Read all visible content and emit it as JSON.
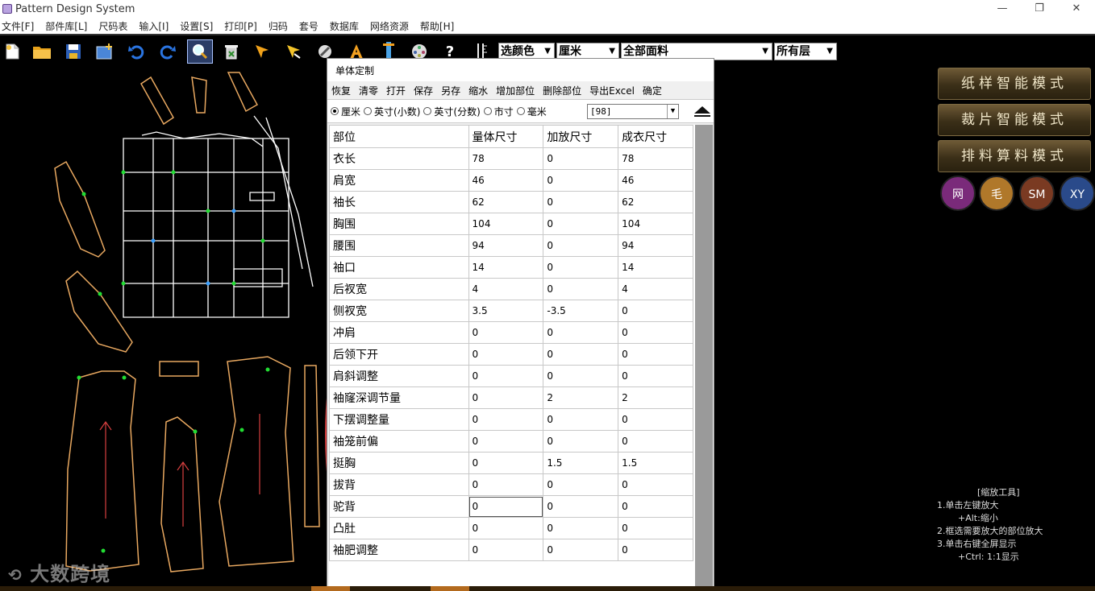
{
  "window": {
    "title": "Pattern Design System",
    "controls": [
      "—",
      "❐",
      "✕"
    ]
  },
  "menu": [
    "文件[F]",
    "部件库[L]",
    "尺码表",
    "输入[I]",
    "设置[S]",
    "打印[P]",
    "归码",
    "套号",
    "数据库",
    "网络资源",
    "帮助[H]"
  ],
  "toolbar": {
    "color_select": "选颜色",
    "unit_select": "厘米",
    "fabric_select": "全部面料",
    "layer_select": "所有层",
    "help_glyph": "?"
  },
  "dialog": {
    "title": "单体定制",
    "menu": [
      "恢复",
      "清零",
      "打开",
      "保存",
      "另存",
      "缩水",
      "增加部位",
      "删除部位",
      "导出Excel",
      "确定"
    ],
    "units": [
      {
        "label": "厘米",
        "selected": true
      },
      {
        "label": "英寸(小数)",
        "selected": false
      },
      {
        "label": "英寸(分数)",
        "selected": false
      },
      {
        "label": "市寸",
        "selected": false
      },
      {
        "label": "毫米",
        "selected": false
      }
    ],
    "size_value": "[98]",
    "columns": [
      "部位",
      "量体尺寸",
      "加放尺寸",
      "成衣尺寸"
    ],
    "rows": [
      [
        "衣长",
        "78",
        "0",
        "78"
      ],
      [
        "肩宽",
        "46",
        "0",
        "46"
      ],
      [
        "袖长",
        "62",
        "0",
        "62"
      ],
      [
        "胸围",
        "104",
        "0",
        "104"
      ],
      [
        "腰围",
        "94",
        "0",
        "94"
      ],
      [
        "袖口",
        "14",
        "0",
        "14"
      ],
      [
        "后衩宽",
        "4",
        "0",
        "4"
      ],
      [
        "侧衩宽",
        "3.5",
        "-3.5",
        "0"
      ],
      [
        "冲肩",
        "0",
        "0",
        "0"
      ],
      [
        "后领下开",
        "0",
        "0",
        "0"
      ],
      [
        "肩斜调整",
        "0",
        "0",
        "0"
      ],
      [
        "袖窿深调节量",
        "0",
        "2",
        "2"
      ],
      [
        "下摆调整量",
        "0",
        "0",
        "0"
      ],
      [
        "袖笼前偏",
        "0",
        "0",
        "0"
      ],
      [
        "挺胸",
        "0",
        "1.5",
        "1.5"
      ],
      [
        "拔背",
        "0",
        "0",
        "0"
      ],
      [
        "驼背",
        "0",
        "0",
        "0"
      ],
      [
        "凸肚",
        "0",
        "0",
        "0"
      ],
      [
        "袖肥调整",
        "0",
        "0",
        "0"
      ]
    ]
  },
  "right_panel": {
    "modes": [
      "纸样智能模式",
      "裁片智能模式",
      "排料算料模式"
    ],
    "circle_buttons": [
      {
        "label": "网",
        "color": "#7a2a7a"
      },
      {
        "label": "毛",
        "color": "#b0782a"
      },
      {
        "label": "SM",
        "color": "#7a3a22"
      },
      {
        "label": "XY",
        "color": "#2a4a8a"
      }
    ],
    "zoom_help": {
      "title": "[缩放工具]",
      "lines": [
        "1.单击左键放大",
        "+Alt:缩小",
        "2.框选需要放大的部位放大",
        "3.单击右键全屏显示",
        "+Ctrl: 1:1显示"
      ]
    }
  },
  "watermark": "大数跨境",
  "colors": {
    "pattern_line": "#e8a860",
    "grid_line": "#ffffff",
    "annotation": "#d33c3c"
  }
}
